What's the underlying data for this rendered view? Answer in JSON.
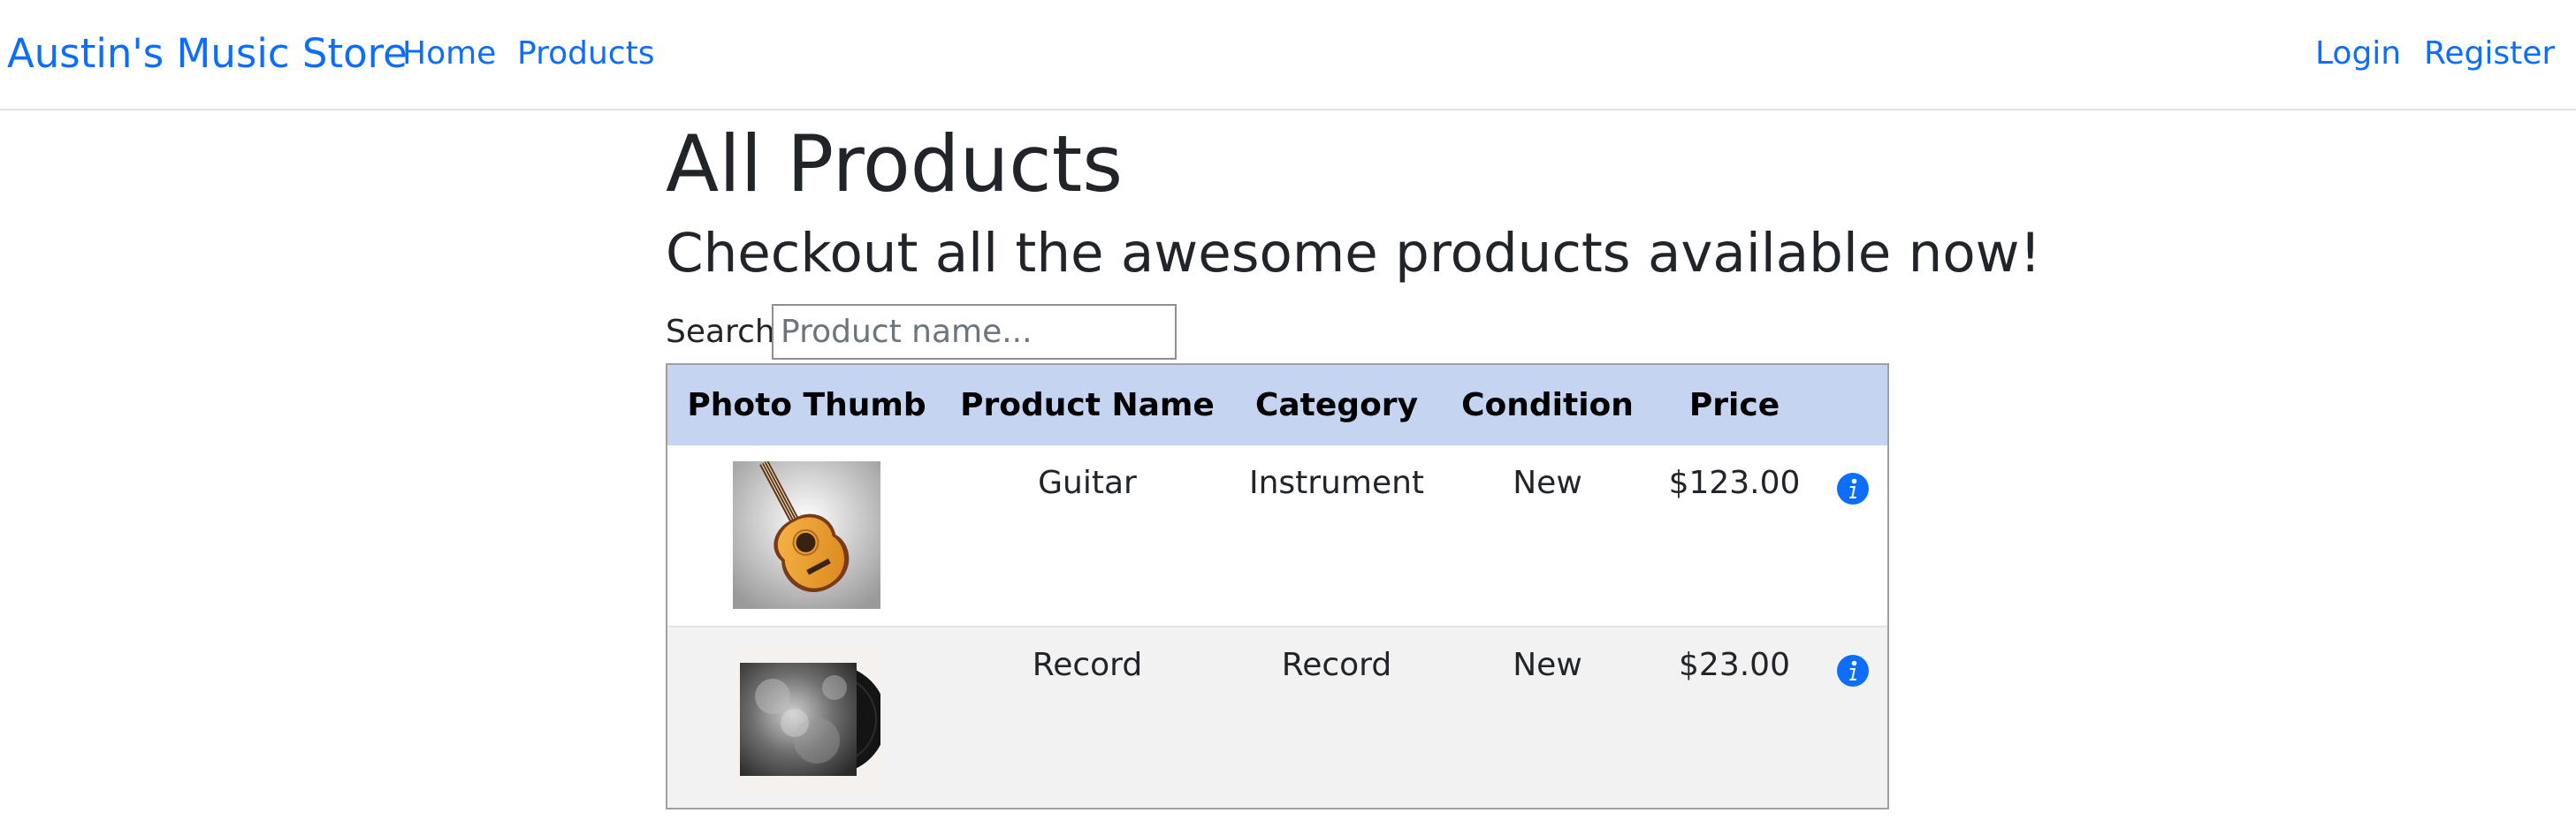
{
  "navbar": {
    "brand": "Austin's Music Store",
    "links": [
      {
        "label": "Home"
      },
      {
        "label": "Products"
      }
    ],
    "auth": [
      {
        "label": "Login"
      },
      {
        "label": "Register"
      }
    ]
  },
  "page": {
    "title": "All Products",
    "subtitle": "Checkout all the awesome products available now!"
  },
  "search": {
    "label": "Search:",
    "value": "",
    "placeholder": "Product name..."
  },
  "table": {
    "headers": [
      "Photo Thumb",
      "Product Name",
      "Category",
      "Condition",
      "Price",
      ""
    ],
    "rows": [
      {
        "photo": "guitar-photo",
        "name": "Guitar",
        "category": "Instrument",
        "condition": "New",
        "price": "$123.00",
        "action_icon": "info-icon"
      },
      {
        "photo": "record-photo",
        "name": "Record",
        "category": "Record",
        "condition": "New",
        "price": "$23.00",
        "action_icon": "info-icon"
      }
    ]
  },
  "colors": {
    "link": "#0d6efd",
    "table_header_bg": "#c5d5f1",
    "info_icon": "#0d6efd"
  }
}
